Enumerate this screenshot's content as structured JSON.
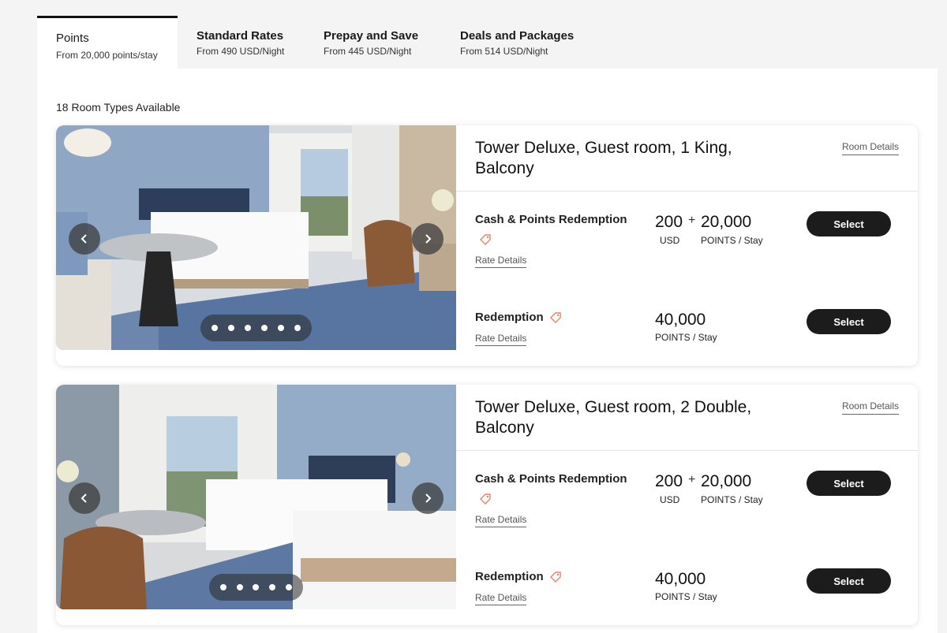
{
  "tabs": [
    {
      "label": "Points",
      "sub": "From 20,000 points/stay",
      "active": true
    },
    {
      "label": "Standard Rates",
      "sub": "From 490 USD/Night"
    },
    {
      "label": "Prepay and Save",
      "sub": "From 445 USD/Night"
    },
    {
      "label": "Deals and Packages",
      "sub": "From 514 USD/Night"
    }
  ],
  "available": "18 Room Types Available",
  "rooms": [
    {
      "title": "Tower Deluxe, Guest room, 1 King, Balcony",
      "room_details": "Room Details",
      "photo_dots": 6,
      "rates": [
        {
          "name": "Cash & Points Redemption",
          "details": "Rate Details",
          "cash": "200",
          "cash_unit": "USD",
          "plus": "+",
          "points": "20,000",
          "points_unit": "POINTS / Stay",
          "button": "Select"
        },
        {
          "name": "Redemption",
          "details": "Rate Details",
          "points": "40,000",
          "points_unit": "POINTS / Stay",
          "button": "Select"
        }
      ]
    },
    {
      "title": "Tower Deluxe, Guest room, 2 Double, Balcony",
      "room_details": "Room Details",
      "photo_dots": 5,
      "rates": [
        {
          "name": "Cash & Points Redemption",
          "details": "Rate Details",
          "cash": "200",
          "cash_unit": "USD",
          "plus": "+",
          "points": "20,000",
          "points_unit": "POINTS / Stay",
          "button": "Select"
        },
        {
          "name": "Redemption",
          "details": "Rate Details",
          "points": "40,000",
          "points_unit": "POINTS / Stay",
          "button": "Select"
        }
      ]
    }
  ],
  "colors": {
    "button": "#1c1c1c",
    "tag": "#e8826a",
    "page_bg": "#f4f4f4"
  },
  "icons": {
    "prev": "chevron-left-icon",
    "next": "chevron-right-icon",
    "tag": "price-tag-icon"
  }
}
